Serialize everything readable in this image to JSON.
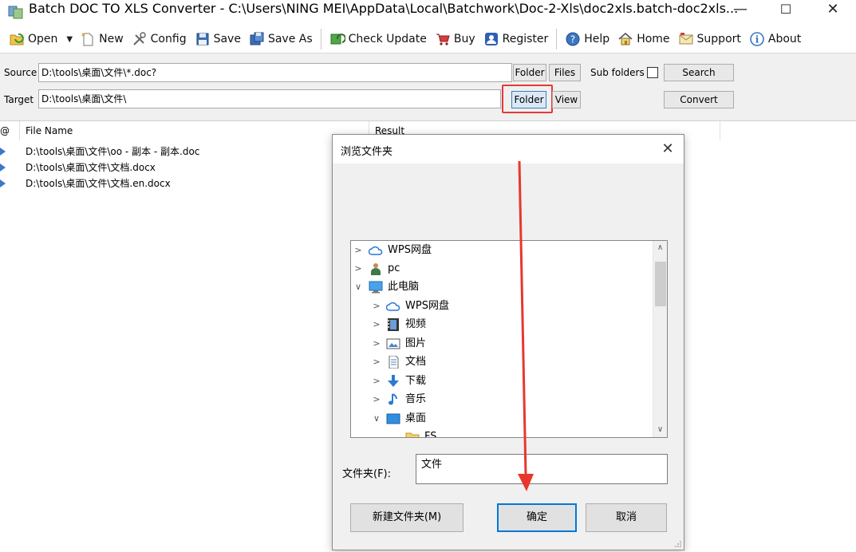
{
  "window": {
    "title": "Batch DOC TO XLS Converter - C:\\Users\\NING MEI\\AppData\\Local\\Batchwork\\Doc-2-Xls\\doc2xls.batch-doc2xls...",
    "minimize": "—",
    "maximize": "☐",
    "close": "✕"
  },
  "toolbar": {
    "open": "Open",
    "new": "New",
    "config": "Config",
    "save": "Save",
    "save_as": "Save As",
    "check_update": "Check Update",
    "buy": "Buy",
    "register": "Register",
    "help": "Help",
    "home": "Home",
    "support": "Support",
    "about": "About"
  },
  "source": {
    "label": "Source",
    "value": "D:\\tools\\桌面\\文件\\*.doc?",
    "folder_btn": "Folder",
    "files_btn": "Files",
    "subfolders_label": "Sub folders",
    "search_btn": "Search"
  },
  "target": {
    "label": "Target",
    "value": "D:\\tools\\桌面\\文件\\",
    "folder_btn": "Folder",
    "view_btn": "View",
    "convert_btn": "Convert"
  },
  "list": {
    "col_index": "@",
    "col_filename": "File Name",
    "col_result": "Result",
    "rows": [
      "D:\\tools\\桌面\\文件\\oo - 副本 - 副本.doc",
      "D:\\tools\\桌面\\文件\\文档.docx",
      "D:\\tools\\桌面\\文件\\文档.en.docx"
    ]
  },
  "dialog": {
    "title": "浏览文件夹",
    "close": "✕",
    "tree": [
      {
        "label": "WPS网盘",
        "icon": "cloud-icon"
      },
      {
        "label": "pc",
        "icon": "user-icon"
      },
      {
        "label": "此电脑",
        "icon": "computer-icon"
      },
      {
        "label": "WPS网盘",
        "icon": "cloud-icon"
      },
      {
        "label": "视频",
        "icon": "video-icon"
      },
      {
        "label": "图片",
        "icon": "picture-icon"
      },
      {
        "label": "文档",
        "icon": "document-icon"
      },
      {
        "label": "下载",
        "icon": "download-icon"
      },
      {
        "label": "音乐",
        "icon": "music-icon"
      },
      {
        "label": "桌面",
        "icon": "desktop-icon"
      },
      {
        "label": "FS",
        "icon": "folder-icon"
      }
    ],
    "folder_label": "文件夹(F):",
    "folder_value": "文件",
    "new_folder_btn": "新建文件夹(M)",
    "ok_btn": "确定",
    "cancel_btn": "取消"
  },
  "colors": {
    "highlight": "#e53935",
    "annotation_arrow": "#e8372c",
    "primary_border": "#0078d7"
  }
}
